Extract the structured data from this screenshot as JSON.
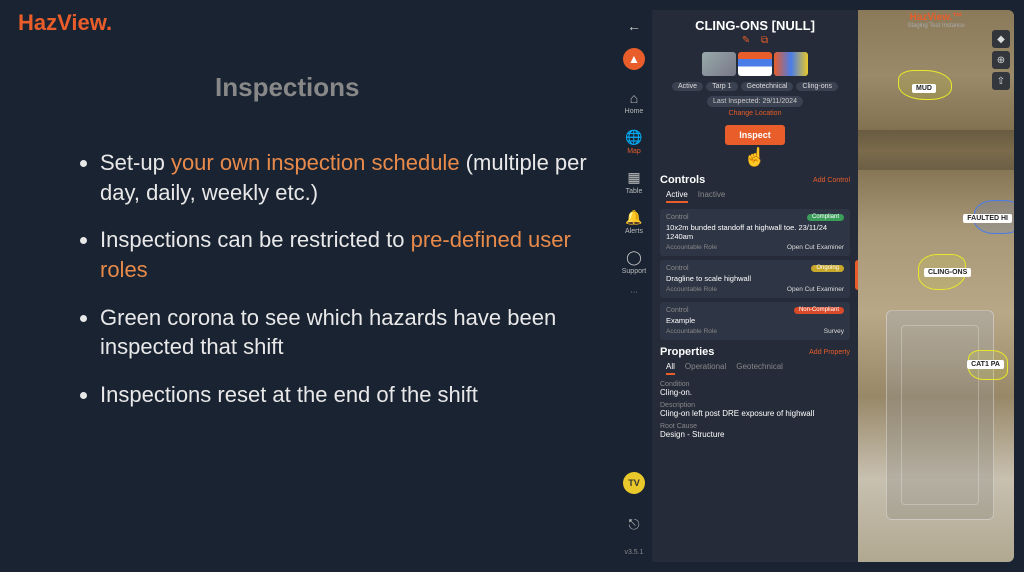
{
  "brand": "HazView.",
  "slide_title": "Inspections",
  "bullets": {
    "b1a": "Set-up ",
    "b1b": "your own inspection schedule",
    "b1c": " (multiple per day, daily, weekly etc.)",
    "b2a": "Inspections can be restricted to ",
    "b2b": "pre-defined user roles",
    "b3": "Green corona to see which hazards have been inspected that shift",
    "b4": "Inspections reset at the end of the shift"
  },
  "app": {
    "header_brand": "HazView.™",
    "header_sub": "Staging Test Instance",
    "sidebar": {
      "home": "Home",
      "map": "Map",
      "table": "Table",
      "alerts": "Alerts",
      "support": "Support",
      "more": "···",
      "tv": "TV",
      "version": "v3.5.1"
    },
    "panel": {
      "title": "CLING-ONS [NULL]",
      "tags": [
        "Active",
        "Tarp 1",
        "Geotechnical",
        "Cling-ons"
      ],
      "last_inspected": "Last Inspected: 29/11/2024",
      "change_location": "Change Location",
      "inspect_btn": "Inspect",
      "controls_heading": "Controls",
      "add_control": "Add Control",
      "tabs": {
        "active": "Active",
        "inactive": "Inactive"
      },
      "controls": [
        {
          "label": "Control",
          "status": "Compliant",
          "status_class": "sp-green",
          "desc": "10x2m bunded standoff at highwall toe. 23/11/24 1240am",
          "role_label": "Accountable Role",
          "role": "Open Cut Examiner"
        },
        {
          "label": "Control",
          "status": "Ongoing",
          "status_class": "sp-yellow",
          "desc": "Dragline to scale highwall",
          "role_label": "Accountable Role",
          "role": "Open Cut Examiner"
        },
        {
          "label": "Control",
          "status": "Non-Compliant",
          "status_class": "sp-red",
          "desc": "Example",
          "role_label": "Accountable Role",
          "role": "Survey"
        }
      ],
      "properties_heading": "Properties",
      "add_property": "Add Property",
      "prop_tabs": {
        "all": "All",
        "operational": "Operational",
        "geotech": "Geotechnical"
      },
      "props": {
        "condition_label": "Condition",
        "condition": "Cling-on.",
        "description_label": "Description",
        "description": "Cling-on left post DRE exposure of highwall",
        "root_label": "Root Cause",
        "root": "Design - Structure"
      }
    },
    "map_labels": {
      "mud": "MUD",
      "faulted": "FAULTED HI",
      "cling": "CLING-ONS",
      "cat": "CAT1 PA"
    }
  }
}
